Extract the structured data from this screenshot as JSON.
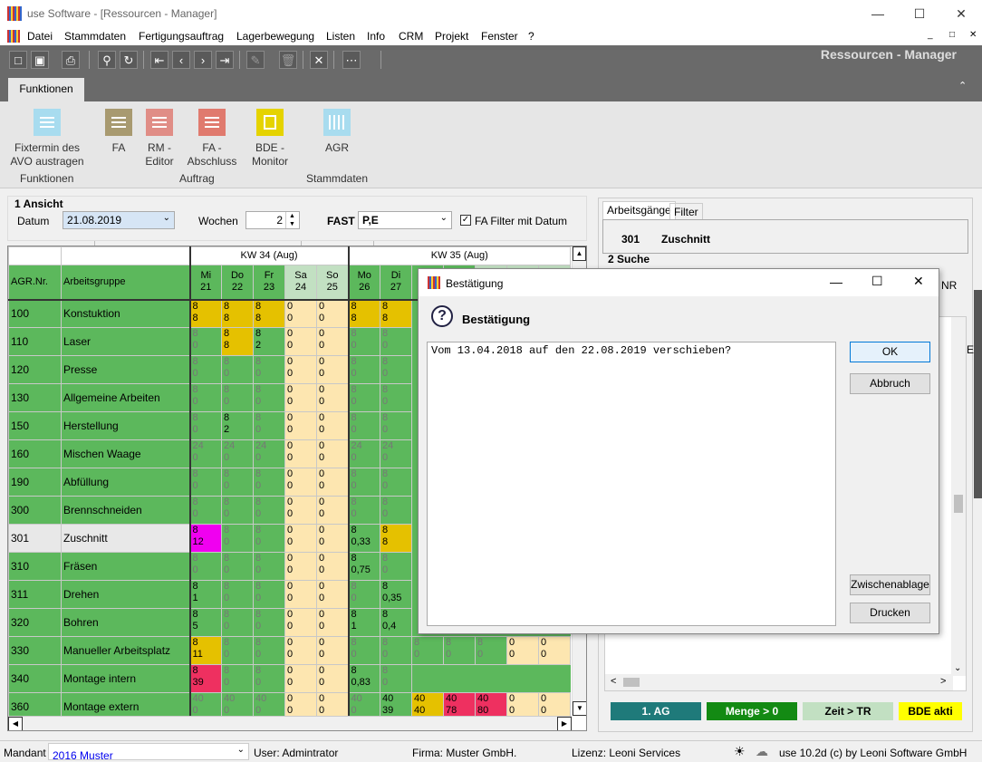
{
  "window": {
    "title": "use Software - [Ressourcen - Manager]"
  },
  "menu": [
    "Datei",
    "Stammdaten",
    "Fertigungsauftrag",
    "Lagerbewegung",
    "Listen",
    "Info",
    "CRM",
    "Projekt",
    "Fenster",
    "?"
  ],
  "app_title": "Ressourcen - Manager",
  "ribbon": {
    "tab": "Funktionen",
    "btn_fixtermin": "Fixtermin des AVO austragen",
    "grp_funktionen": "Funktionen",
    "btn_fa": "FA",
    "btn_rm": "RM - Editor",
    "btn_fa_abschluss": "FA - Abschluss",
    "btn_bde": "BDE - Monitor",
    "grp_auftrag": "Auftrag",
    "btn_agr": "AGR",
    "grp_stammdaten": "Stammdaten"
  },
  "ansicht": {
    "title": "1 Ansicht",
    "datum_label": "Datum",
    "datum_value": "21.08.2019",
    "wochen_label": "Wochen",
    "wochen_value": "2",
    "fast_label": "FAST",
    "fast_value": "P,E",
    "filter_label": "FA Filter mit Datum"
  },
  "grid": {
    "week1": "KW 34 (Aug)",
    "week2": "KW 35 (Aug)",
    "col_nr": "AGR.Nr.",
    "col_name": "Arbeitsgruppe",
    "days": [
      [
        "Mi",
        "21"
      ],
      [
        "Do",
        "22"
      ],
      [
        "Fr",
        "23"
      ],
      [
        "Sa",
        "24"
      ],
      [
        "So",
        "25"
      ],
      [
        "Mo",
        "26"
      ],
      [
        "Di",
        "27"
      ],
      [
        "",
        ""
      ],
      [
        "",
        ""
      ],
      [
        "",
        ""
      ],
      [
        "",
        ""
      ],
      [
        "",
        ""
      ]
    ],
    "rows": [
      {
        "nr": "100",
        "name": "Konstuktion",
        "cells": [
          [
            "8",
            "8",
            "y"
          ],
          [
            "8",
            "8",
            "y"
          ],
          [
            "8",
            "8",
            "y"
          ],
          [
            "0",
            "0",
            "s"
          ],
          [
            "0",
            "0",
            "s"
          ],
          [
            "8",
            "8",
            "y"
          ],
          [
            "8",
            "8",
            "y"
          ]
        ]
      },
      {
        "nr": "110",
        "name": "Laser",
        "cells": [
          [
            "8",
            "0",
            ""
          ],
          [
            "8",
            "8",
            "y"
          ],
          [
            "8",
            "2",
            "g"
          ],
          [
            "0",
            "0",
            "s"
          ],
          [
            "0",
            "0",
            "s"
          ],
          [
            "8",
            "0",
            ""
          ],
          [
            "8",
            "0",
            ""
          ]
        ]
      },
      {
        "nr": "120",
        "name": "Presse",
        "cells": [
          [
            "8",
            "0",
            ""
          ],
          [
            "8",
            "0",
            ""
          ],
          [
            "8",
            "0",
            ""
          ],
          [
            "0",
            "0",
            "s"
          ],
          [
            "0",
            "0",
            "s"
          ],
          [
            "8",
            "0",
            ""
          ],
          [
            "8",
            "0",
            ""
          ]
        ]
      },
      {
        "nr": "130",
        "name": "Allgemeine Arbeiten",
        "cells": [
          [
            "8",
            "0",
            ""
          ],
          [
            "8",
            "0",
            ""
          ],
          [
            "8",
            "0",
            ""
          ],
          [
            "0",
            "0",
            "s"
          ],
          [
            "0",
            "0",
            "s"
          ],
          [
            "8",
            "0",
            ""
          ],
          [
            "8",
            "0",
            ""
          ]
        ]
      },
      {
        "nr": "150",
        "name": "Herstellung",
        "cells": [
          [
            "8",
            "0",
            ""
          ],
          [
            "8",
            "2",
            "g"
          ],
          [
            "8",
            "0",
            ""
          ],
          [
            "0",
            "0",
            "s"
          ],
          [
            "0",
            "0",
            "s"
          ],
          [
            "8",
            "0",
            ""
          ],
          [
            "8",
            "0",
            ""
          ]
        ]
      },
      {
        "nr": "160",
        "name": "Mischen Waage",
        "cells": [
          [
            "24",
            "0",
            ""
          ],
          [
            "24",
            "0",
            ""
          ],
          [
            "24",
            "0",
            ""
          ],
          [
            "0",
            "0",
            "s"
          ],
          [
            "0",
            "0",
            "s"
          ],
          [
            "24",
            "0",
            ""
          ],
          [
            "24",
            "0",
            ""
          ]
        ]
      },
      {
        "nr": "190",
        "name": "Abfüllung",
        "cells": [
          [
            "8",
            "0",
            ""
          ],
          [
            "8",
            "0",
            ""
          ],
          [
            "8",
            "0",
            ""
          ],
          [
            "0",
            "0",
            "s"
          ],
          [
            "0",
            "0",
            "s"
          ],
          [
            "8",
            "0",
            ""
          ],
          [
            "8",
            "0",
            ""
          ]
        ]
      },
      {
        "nr": "300",
        "name": "Brennschneiden",
        "cells": [
          [
            "8",
            "0",
            ""
          ],
          [
            "8",
            "0",
            ""
          ],
          [
            "8",
            "0",
            ""
          ],
          [
            "0",
            "0",
            "s"
          ],
          [
            "0",
            "0",
            "s"
          ],
          [
            "8",
            "0",
            ""
          ],
          [
            "8",
            "0",
            ""
          ]
        ]
      },
      {
        "nr": "301",
        "name": "Zuschnitt",
        "cells": [
          [
            "8",
            "12",
            "m"
          ],
          [
            "8",
            "0",
            ""
          ],
          [
            "8",
            "0",
            ""
          ],
          [
            "0",
            "0",
            "s"
          ],
          [
            "0",
            "0",
            "s"
          ],
          [
            "8",
            "0,33",
            "g"
          ],
          [
            "8",
            "8",
            "y"
          ]
        ]
      },
      {
        "nr": "310",
        "name": "Fräsen",
        "cells": [
          [
            "8",
            "0",
            ""
          ],
          [
            "8",
            "0",
            ""
          ],
          [
            "8",
            "0",
            ""
          ],
          [
            "0",
            "0",
            "s"
          ],
          [
            "0",
            "0",
            "s"
          ],
          [
            "8",
            "0,75",
            "g"
          ],
          [
            "8",
            "0",
            ""
          ]
        ]
      },
      {
        "nr": "311",
        "name": "Drehen",
        "cells": [
          [
            "8",
            "1",
            "g"
          ],
          [
            "8",
            "0",
            ""
          ],
          [
            "8",
            "0",
            ""
          ],
          [
            "0",
            "0",
            "s"
          ],
          [
            "0",
            "0",
            "s"
          ],
          [
            "8",
            "0",
            ""
          ],
          [
            "8",
            "0,35",
            "g"
          ]
        ]
      },
      {
        "nr": "320",
        "name": "Bohren",
        "cells": [
          [
            "8",
            "5",
            "g"
          ],
          [
            "8",
            "0",
            ""
          ],
          [
            "8",
            "0",
            ""
          ],
          [
            "0",
            "0",
            "s"
          ],
          [
            "0",
            "0",
            "s"
          ],
          [
            "8",
            "1",
            "g"
          ],
          [
            "8",
            "0,4",
            "g"
          ]
        ]
      },
      {
        "nr": "330",
        "name": "Manueller Arbeitsplatz",
        "cells": [
          [
            "8",
            "11",
            "y"
          ],
          [
            "8",
            "0",
            ""
          ],
          [
            "8",
            "0",
            ""
          ],
          [
            "0",
            "0",
            "s"
          ],
          [
            "0",
            "0",
            "s"
          ],
          [
            "8",
            "0",
            ""
          ],
          [
            "8",
            "0",
            ""
          ]
        ]
      },
      {
        "nr": "340",
        "name": "Montage intern",
        "cells": [
          [
            "8",
            "39",
            "r"
          ],
          [
            "8",
            "0",
            ""
          ],
          [
            "8",
            "0",
            ""
          ],
          [
            "0",
            "0",
            "s"
          ],
          [
            "0",
            "0",
            "s"
          ],
          [
            "8",
            "0,83",
            "g"
          ],
          [
            "8",
            "0",
            ""
          ]
        ]
      },
      {
        "nr": "360",
        "name": "Montage extern",
        "cells": [
          [
            "40",
            "0",
            ""
          ],
          [
            "40",
            "0",
            ""
          ],
          [
            "40",
            "0",
            ""
          ],
          [
            "0",
            "0",
            "s"
          ],
          [
            "0",
            "0",
            "s"
          ],
          [
            "40",
            "0",
            ""
          ],
          [
            "40",
            "39",
            "g"
          ]
        ]
      }
    ],
    "extra_330": [
      [
        "8",
        "0",
        ""
      ],
      [
        "8",
        "0",
        ""
      ],
      [
        "8",
        "0",
        ""
      ],
      [
        "0",
        "0",
        "s"
      ],
      [
        "0",
        "0",
        "s"
      ]
    ],
    "extra_360": [
      [
        "40",
        "40",
        "y"
      ],
      [
        "40",
        "78",
        "r"
      ],
      [
        "40",
        "80",
        "r"
      ],
      [
        "0",
        "0",
        "s"
      ],
      [
        "0",
        "0",
        "s"
      ]
    ]
  },
  "right": {
    "tab1": "Arbeitsgänge",
    "tab2": "Filter",
    "ag_nr": "301",
    "ag_name": "Zuschnitt",
    "suche": "2 Suche",
    "nr_hint": "NR",
    "ae_hint": "AE"
  },
  "legend": [
    {
      "label": "1. AG",
      "bg": "#1f7a7a",
      "fg": "#fff"
    },
    {
      "label": "Menge > 0",
      "bg": "#138a13",
      "fg": "#fff"
    },
    {
      "label": "Zeit > TR",
      "bg": "#c2e0c2",
      "fg": "#000"
    },
    {
      "label": "BDE akti",
      "bg": "#ffff00",
      "fg": "#000"
    }
  ],
  "dialog": {
    "title": "Bestätigung",
    "heading": "Bestätigung",
    "message": "Vom 13.04.2018 auf den 22.08.2019 verschieben?",
    "ok": "OK",
    "cancel": "Abbruch",
    "clipboard": "Zwischenablage",
    "print": "Drucken"
  },
  "status": {
    "mandant_label": "Mandant",
    "mandant_value": "2016 Muster",
    "user": "User: Admintrator",
    "firma": "Firma: Muster GmbH.",
    "lizenz": "Lizenz: Leoni Services",
    "version": "use 10.2d (c) by Leoni Software GmbH"
  }
}
